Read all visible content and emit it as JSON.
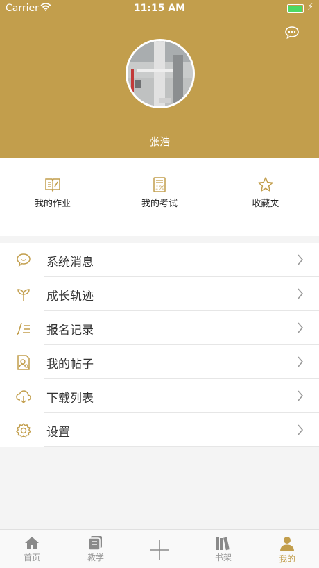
{
  "status_bar": {
    "carrier": "Carrier",
    "time": "11:15 AM"
  },
  "profile": {
    "username": "张浩"
  },
  "quick_actions": [
    {
      "label": "我的作业",
      "icon": "homework-book-icon"
    },
    {
      "label": "我的考试",
      "icon": "exam-paper-icon"
    },
    {
      "label": "收藏夹",
      "icon": "star-icon"
    }
  ],
  "menu": [
    {
      "label": "系统消息",
      "icon": "message-bubble-icon"
    },
    {
      "label": "成长轨迹",
      "icon": "sprout-icon"
    },
    {
      "label": "报名记录",
      "icon": "registration-list-icon"
    },
    {
      "label": "我的帖子",
      "icon": "post-document-icon"
    },
    {
      "label": "下载列表",
      "icon": "cloud-download-icon"
    },
    {
      "label": "设置",
      "icon": "gear-icon"
    }
  ],
  "tabbar": [
    {
      "label": "首页",
      "icon": "home-icon"
    },
    {
      "label": "教学",
      "icon": "teaching-icon"
    },
    {
      "label": "",
      "icon": "plus-icon"
    },
    {
      "label": "书架",
      "icon": "bookshelf-icon"
    },
    {
      "label": "我的",
      "icon": "profile-icon"
    }
  ],
  "colors": {
    "accent": "#c29e4c",
    "battery": "#4cd964"
  }
}
